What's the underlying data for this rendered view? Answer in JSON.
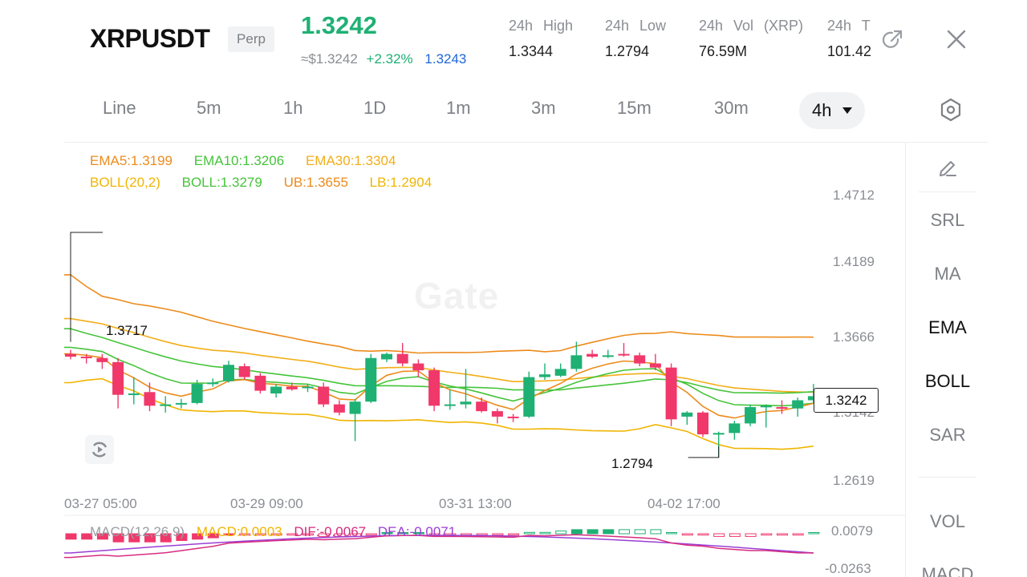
{
  "header": {
    "symbol": "XRPUSDT",
    "contract_type": "Perp",
    "last_price": "1.3242",
    "usd_price": "≈$1.3242",
    "change_pct": "+2.32%",
    "mark_price": "1.3243",
    "stats": [
      {
        "label": "24h High",
        "value": "1.3344"
      },
      {
        "label": "24h Low",
        "value": "1.2794"
      },
      {
        "label": "24h Vol (XRP)",
        "value": "76.59M"
      },
      {
        "label": "24h T",
        "value": "101.42"
      }
    ],
    "share_icon": "share-icon",
    "close_icon": "close-icon"
  },
  "timeframes": {
    "items": [
      "Line",
      "5m",
      "1h",
      "1D",
      "1m",
      "3m",
      "15m",
      "30m"
    ],
    "selected": "4h",
    "settings_icon": "hexagon-gear-icon"
  },
  "tools": {
    "draw_icon": "pencil-icon",
    "items": [
      "SRL",
      "MA",
      "EMA",
      "BOLL",
      "SAR"
    ],
    "active": [
      "EMA",
      "BOLL"
    ],
    "sub_items": [
      "VOL",
      "MACD"
    ]
  },
  "indicators": {
    "ema5": "EMA5:1.3199",
    "ema10": "EMA10:1.3206",
    "ema30": "EMA30:1.3304",
    "boll_params": "BOLL(20,2)",
    "boll": "BOLL:1.3279",
    "ub": "UB:1.3655",
    "lb": "LB:1.2904"
  },
  "macd_legend": {
    "params": "MACD(12,26,9)",
    "macd": "MACD:0.0003",
    "dif": "DIF:-0.0067",
    "dea": "DEA:-0.0071"
  },
  "chart_data": {
    "type": "candlestick",
    "y_ticks": [
      "1.4712",
      "1.4189",
      "1.3666",
      "1.3142",
      "1.2619"
    ],
    "x_ticks": [
      "03-27 05:00",
      "03-29 09:00",
      "03-31 13:00",
      "04-02 17:00"
    ],
    "macd_ticks": [
      "0.0079",
      "-0.0263"
    ],
    "current_price": "1.3242",
    "high_marker": "1.3717",
    "low_marker": "1.2794",
    "candles": [
      {
        "o": 1.355,
        "h": 1.358,
        "l": 1.351,
        "c": 1.353
      },
      {
        "o": 1.353,
        "h": 1.355,
        "l": 1.348,
        "c": 1.352
      },
      {
        "o": 1.352,
        "h": 1.355,
        "l": 1.344,
        "c": 1.349
      },
      {
        "o": 1.349,
        "h": 1.352,
        "l": 1.315,
        "c": 1.325
      },
      {
        "o": 1.325,
        "h": 1.338,
        "l": 1.318,
        "c": 1.326
      },
      {
        "o": 1.327,
        "h": 1.334,
        "l": 1.313,
        "c": 1.317
      },
      {
        "o": 1.317,
        "h": 1.324,
        "l": 1.312,
        "c": 1.318
      },
      {
        "o": 1.318,
        "h": 1.322,
        "l": 1.315,
        "c": 1.319
      },
      {
        "o": 1.319,
        "h": 1.336,
        "l": 1.318,
        "c": 1.333
      },
      {
        "o": 1.333,
        "h": 1.337,
        "l": 1.331,
        "c": 1.334
      },
      {
        "o": 1.335,
        "h": 1.35,
        "l": 1.334,
        "c": 1.347
      },
      {
        "o": 1.346,
        "h": 1.348,
        "l": 1.336,
        "c": 1.338
      },
      {
        "o": 1.339,
        "h": 1.341,
        "l": 1.326,
        "c": 1.328
      },
      {
        "o": 1.326,
        "h": 1.333,
        "l": 1.323,
        "c": 1.331
      },
      {
        "o": 1.331,
        "h": 1.334,
        "l": 1.328,
        "c": 1.329
      },
      {
        "o": 1.33,
        "h": 1.333,
        "l": 1.327,
        "c": 1.331
      },
      {
        "o": 1.331,
        "h": 1.334,
        "l": 1.316,
        "c": 1.318
      },
      {
        "o": 1.318,
        "h": 1.321,
        "l": 1.31,
        "c": 1.312
      },
      {
        "o": 1.311,
        "h": 1.322,
        "l": 1.291,
        "c": 1.32
      },
      {
        "o": 1.32,
        "h": 1.355,
        "l": 1.319,
        "c": 1.352
      },
      {
        "o": 1.351,
        "h": 1.356,
        "l": 1.349,
        "c": 1.355
      },
      {
        "o": 1.355,
        "h": 1.363,
        "l": 1.346,
        "c": 1.348
      },
      {
        "o": 1.348,
        "h": 1.351,
        "l": 1.338,
        "c": 1.343
      },
      {
        "o": 1.343,
        "h": 1.345,
        "l": 1.313,
        "c": 1.317
      },
      {
        "o": 1.317,
        "h": 1.329,
        "l": 1.314,
        "c": 1.318
      },
      {
        "o": 1.318,
        "h": 1.344,
        "l": 1.315,
        "c": 1.32
      },
      {
        "o": 1.32,
        "h": 1.323,
        "l": 1.312,
        "c": 1.313
      },
      {
        "o": 1.313,
        "h": 1.315,
        "l": 1.304,
        "c": 1.309
      },
      {
        "o": 1.309,
        "h": 1.311,
        "l": 1.305,
        "c": 1.308
      },
      {
        "o": 1.309,
        "h": 1.342,
        "l": 1.308,
        "c": 1.338
      },
      {
        "o": 1.338,
        "h": 1.348,
        "l": 1.336,
        "c": 1.34
      },
      {
        "o": 1.339,
        "h": 1.348,
        "l": 1.338,
        "c": 1.344
      },
      {
        "o": 1.344,
        "h": 1.364,
        "l": 1.342,
        "c": 1.354
      },
      {
        "o": 1.355,
        "h": 1.358,
        "l": 1.352,
        "c": 1.353
      },
      {
        "o": 1.353,
        "h": 1.358,
        "l": 1.352,
        "c": 1.354
      },
      {
        "o": 1.355,
        "h": 1.363,
        "l": 1.353,
        "c": 1.354
      },
      {
        "o": 1.354,
        "h": 1.356,
        "l": 1.346,
        "c": 1.348
      },
      {
        "o": 1.348,
        "h": 1.355,
        "l": 1.343,
        "c": 1.345
      },
      {
        "o": 1.345,
        "h": 1.348,
        "l": 1.302,
        "c": 1.307
      },
      {
        "o": 1.309,
        "h": 1.313,
        "l": 1.303,
        "c": 1.312
      },
      {
        "o": 1.312,
        "h": 1.313,
        "l": 1.294,
        "c": 1.296
      },
      {
        "o": 1.296,
        "h": 1.298,
        "l": 1.279,
        "c": 1.297
      },
      {
        "o": 1.297,
        "h": 1.306,
        "l": 1.292,
        "c": 1.304
      },
      {
        "o": 1.304,
        "h": 1.318,
        "l": 1.302,
        "c": 1.316
      },
      {
        "o": 1.316,
        "h": 1.318,
        "l": 1.301,
        "c": 1.317
      },
      {
        "o": 1.316,
        "h": 1.321,
        "l": 1.311,
        "c": 1.315
      },
      {
        "o": 1.315,
        "h": 1.323,
        "l": 1.309,
        "c": 1.321
      },
      {
        "o": 1.321,
        "h": 1.333,
        "l": 1.319,
        "c": 1.324
      }
    ],
    "macd_hist": [
      -0.004,
      -0.004,
      -0.004,
      -0.006,
      -0.006,
      -0.006,
      -0.006,
      -0.005,
      -0.004,
      -0.003,
      -0.001,
      -0.001,
      -0.001,
      -0.001,
      -0.001,
      -0.001,
      -0.002,
      -0.002,
      -0.002,
      -0.001,
      0.0,
      0.0,
      0.0,
      -0.001,
      -0.001,
      -0.001,
      -0.001,
      -0.001,
      -0.001,
      0.001,
      0.001,
      0.002,
      0.003,
      0.003,
      0.003,
      0.003,
      0.003,
      0.003,
      0.0,
      -0.001,
      -0.001,
      -0.002,
      -0.002,
      -0.002,
      -0.001,
      -0.001,
      -0.001,
      0.0
    ]
  }
}
